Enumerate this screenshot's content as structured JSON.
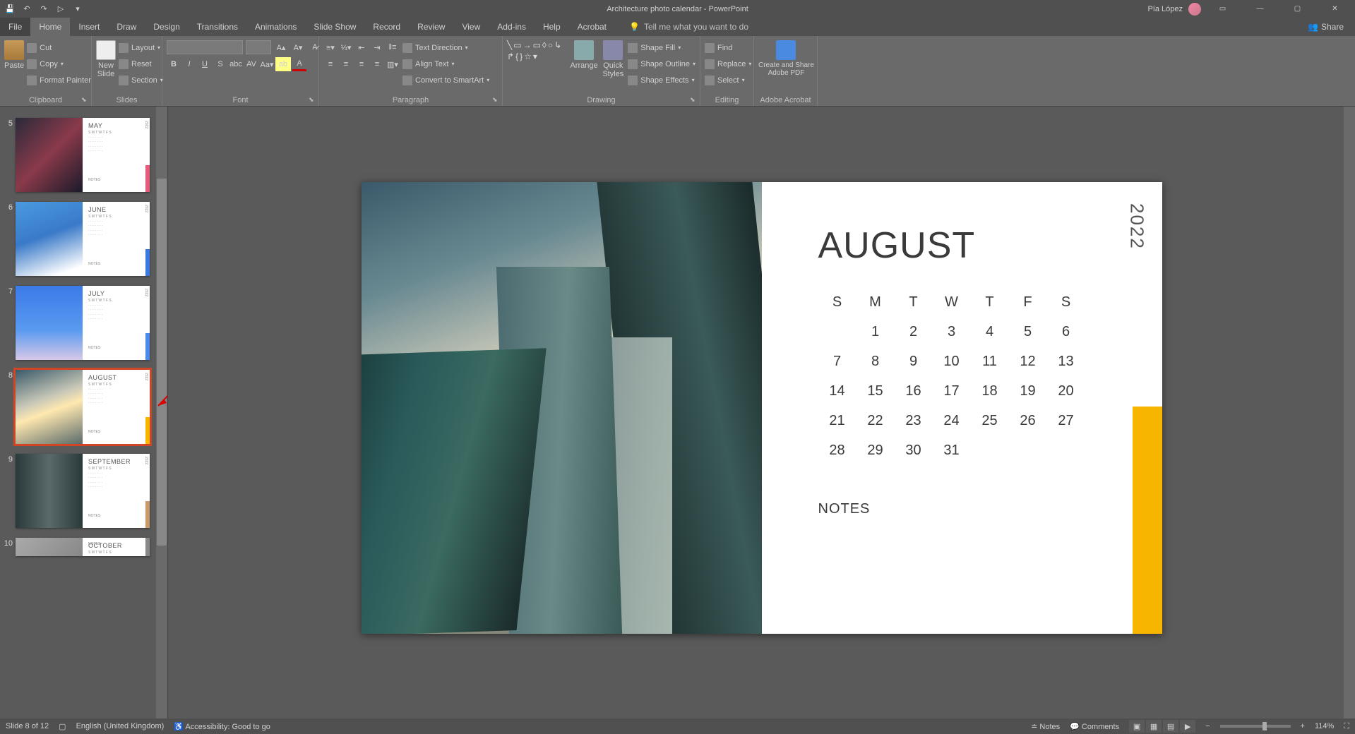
{
  "title": "Architecture photo calendar - PowerPoint",
  "user_name": "Pía López",
  "qat": {
    "save": "💾",
    "undo": "↶",
    "redo": "↷",
    "start": "▷"
  },
  "win": {
    "min": "—",
    "max": "▢",
    "close": "✕",
    "ribbons": "▭"
  },
  "tabs": [
    "File",
    "Home",
    "Insert",
    "Draw",
    "Design",
    "Transitions",
    "Animations",
    "Slide Show",
    "Record",
    "Review",
    "View",
    "Add-ins",
    "Help",
    "Acrobat"
  ],
  "active_tab": "Home",
  "tellme": "Tell me what you want to do",
  "share": "Share",
  "ribbon": {
    "clipboard": {
      "label": "Clipboard",
      "paste": "Paste",
      "cut": "Cut",
      "copy": "Copy",
      "fmtpainter": "Format Painter"
    },
    "slides": {
      "label": "Slides",
      "new": "New\nSlide",
      "layout": "Layout",
      "reset": "Reset",
      "section": "Section"
    },
    "font": {
      "label": "Font"
    },
    "paragraph": {
      "label": "Paragraph",
      "textdir": "Text Direction",
      "align": "Align Text",
      "smartart": "Convert to SmartArt"
    },
    "drawing": {
      "label": "Drawing",
      "arrange": "Arrange",
      "quick": "Quick\nStyles",
      "fill": "Shape Fill",
      "outline": "Shape Outline",
      "effects": "Shape Effects"
    },
    "editing": {
      "label": "Editing",
      "find": "Find",
      "replace": "Replace",
      "select": "Select"
    },
    "acrobat": {
      "label": "Adobe Acrobat",
      "create": "Create and Share\nAdobe PDF"
    }
  },
  "thumbs": [
    {
      "num": "",
      "month": "",
      "accent": "#3aa0e8",
      "photo": "linear-gradient(135deg,#0a3a6a,#1a6a9a,#0a2a4a)"
    },
    {
      "num": "5",
      "month": "MAY",
      "accent": "#e85a7a",
      "photo": "linear-gradient(135deg,#2a2a3a,#8a3a4a,#1a1a2a)"
    },
    {
      "num": "6",
      "month": "JUNE",
      "accent": "#3a7ae0",
      "photo": "linear-gradient(160deg,#4a9ae0,#3a7ac8,#ffffff 90%)"
    },
    {
      "num": "7",
      "month": "JULY",
      "accent": "#4a8ae8",
      "photo": "linear-gradient(180deg,#3a7ae8,#5a9af0 60%,#d8c8e8)"
    },
    {
      "num": "8",
      "month": "AUGUST",
      "accent": "#f7b500",
      "photo": "linear-gradient(160deg,#3a5a6a,#c8c8b8 40%,#ffe8b0 55%,#5a6a6a)",
      "selected": true
    },
    {
      "num": "9",
      "month": "SEPTEMBER",
      "accent": "#c89a6a",
      "photo": "linear-gradient(90deg,#2a3a3a,#5a6a6a,#2a3a3a)"
    },
    {
      "num": "10",
      "month": "OCTOBER",
      "accent": "#888",
      "photo": "linear-gradient(135deg,#aaa,#888)",
      "partial_bottom": true
    }
  ],
  "slide": {
    "year": "2022",
    "month_title": "AUGUST",
    "notes_label": "NOTES",
    "days": [
      "S",
      "M",
      "T",
      "W",
      "T",
      "F",
      "S"
    ],
    "grid": [
      [
        "",
        "1",
        "2",
        "3",
        "4",
        "5",
        "6"
      ],
      [
        "7",
        "8",
        "9",
        "10",
        "11",
        "12",
        "13"
      ],
      [
        "14",
        "15",
        "16",
        "17",
        "18",
        "19",
        "20"
      ],
      [
        "21",
        "22",
        "23",
        "24",
        "25",
        "26",
        "27"
      ],
      [
        "28",
        "29",
        "30",
        "31",
        "",
        "",
        ""
      ]
    ],
    "accent": "#f7b500"
  },
  "status": {
    "slide_of": "Slide 8 of 12",
    "lang": "English (United Kingdom)",
    "accessibility": "Accessibility: Good to go",
    "notes": "Notes",
    "comments": "Comments",
    "zoom": "114%"
  }
}
